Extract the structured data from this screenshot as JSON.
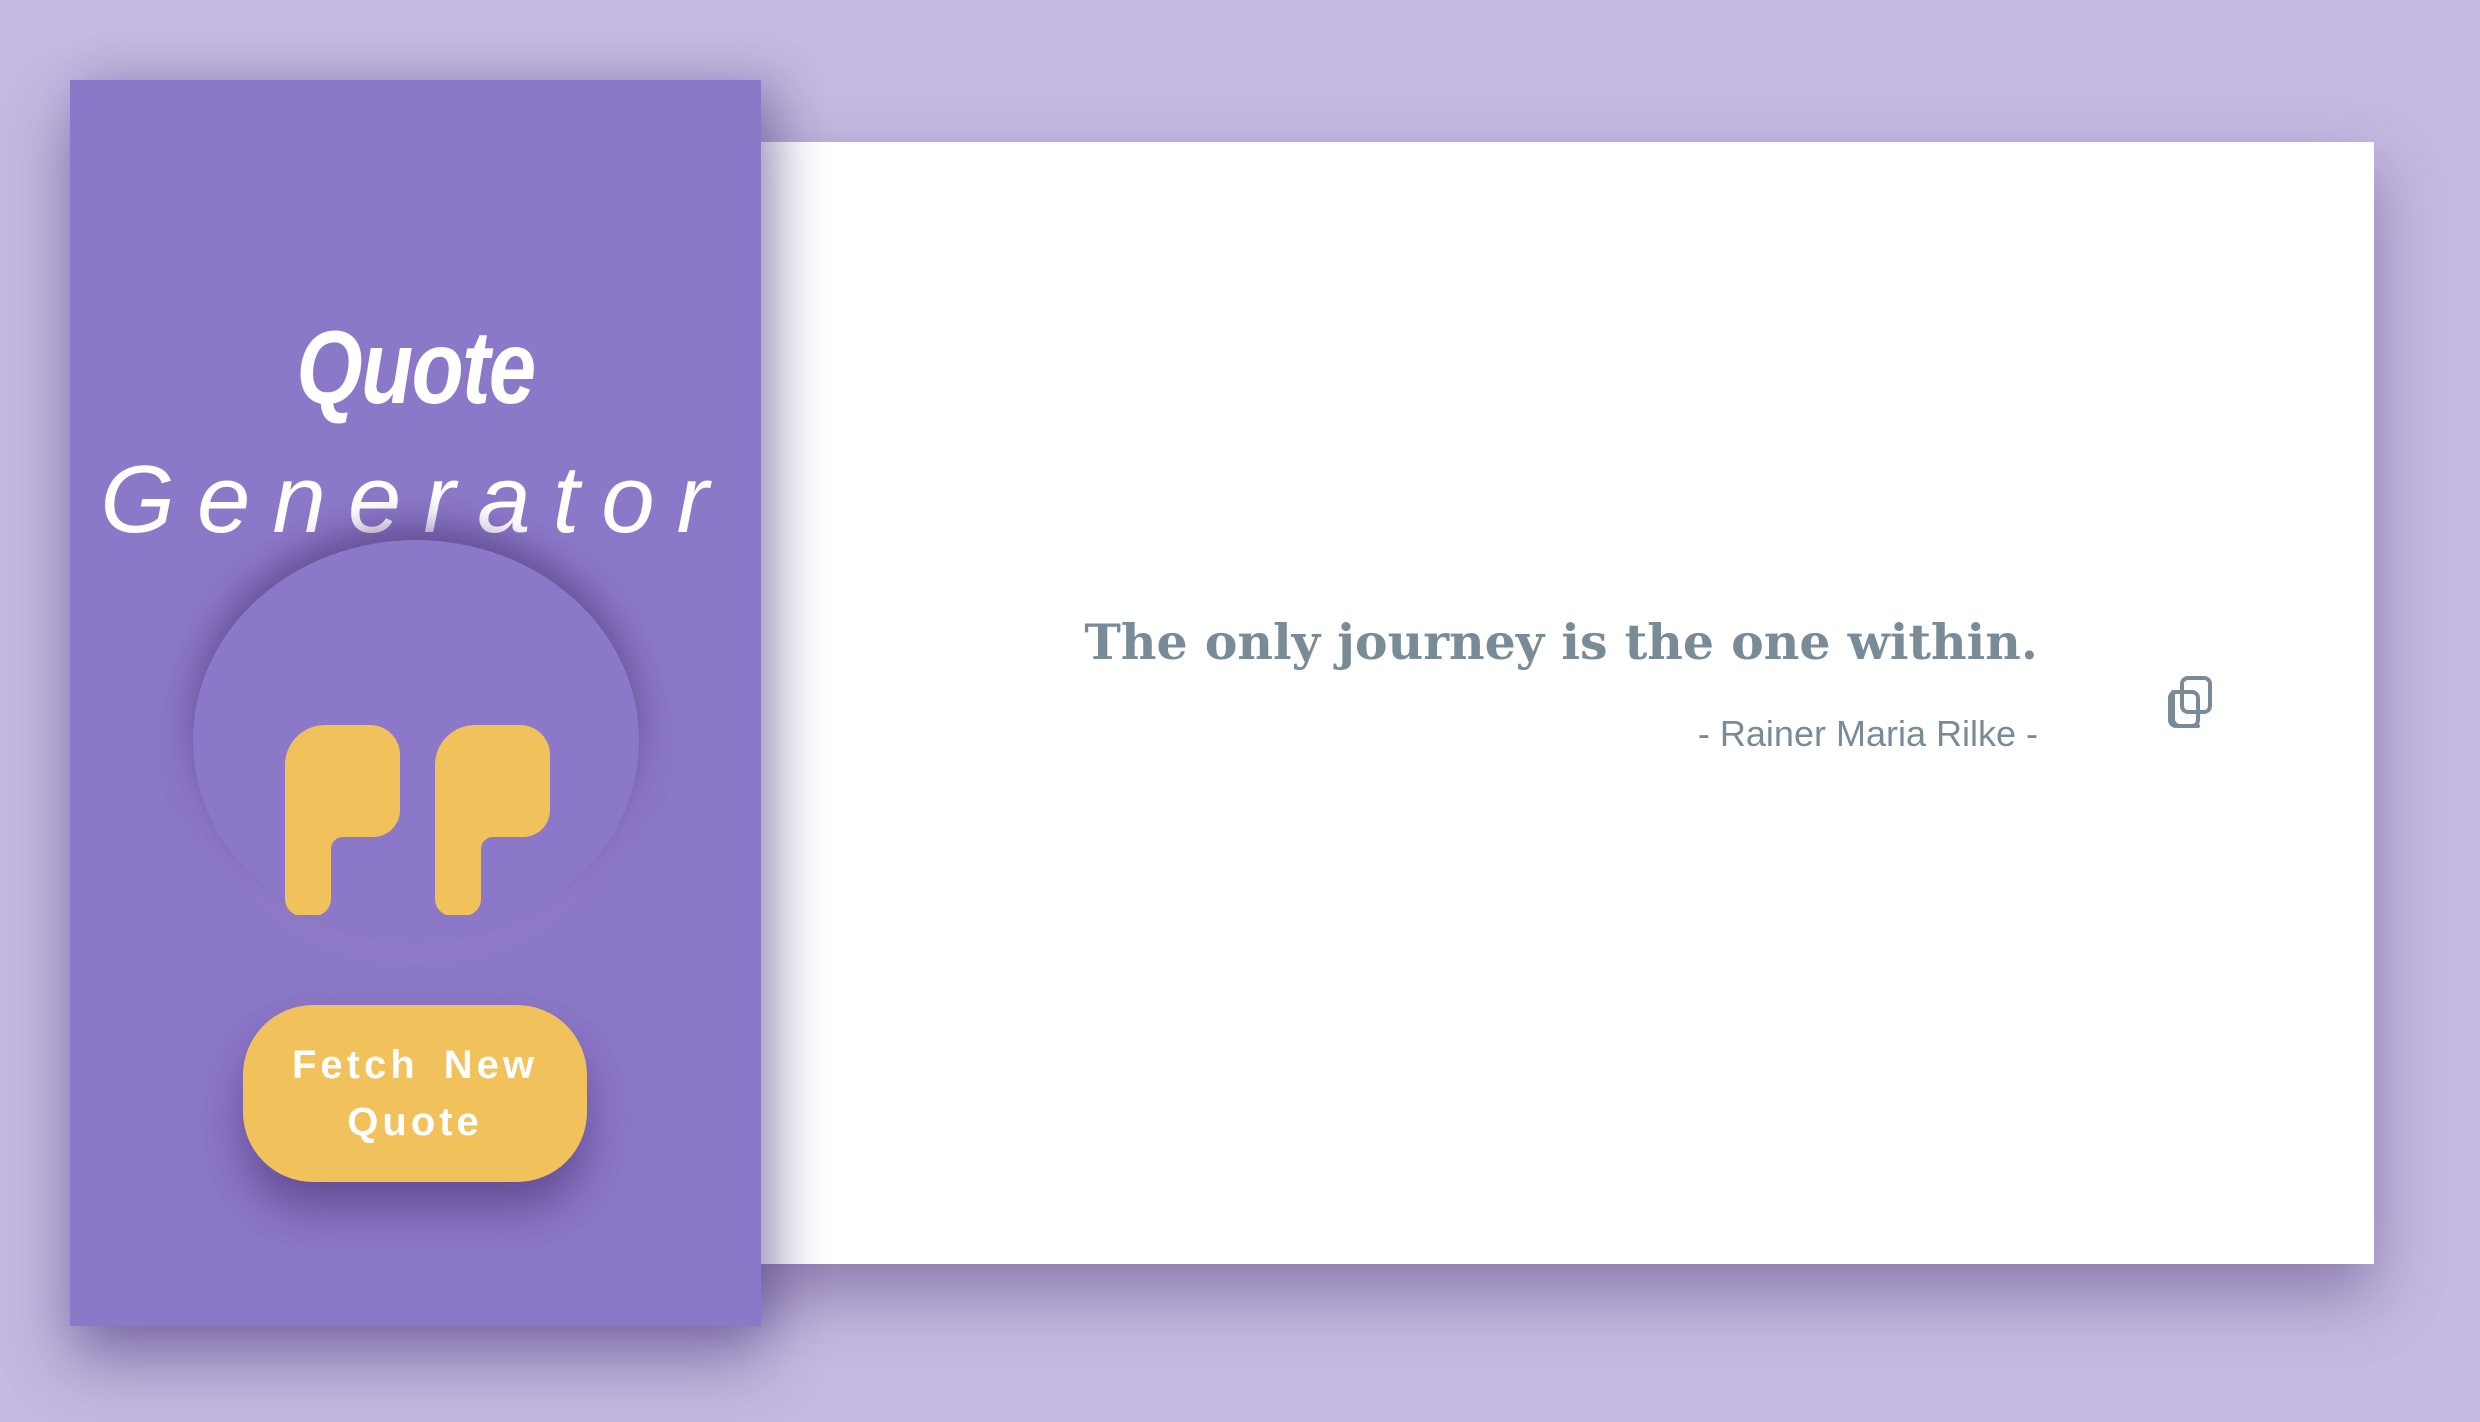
{
  "app": {
    "title_line1": "Quote",
    "title_line2": "Generator"
  },
  "hero_icon": "quote-marks-icon",
  "button": {
    "label": "Fetch New Quote"
  },
  "quote": {
    "text": "The only journey is the one within.",
    "author": "- Rainer Maria Rilke -"
  },
  "copy_icon": "copy-icon",
  "colors": {
    "background": "#c5b9e1",
    "panel": "#8c78c8",
    "accent": "#f1c15c",
    "quote_text": "#798b97",
    "card": "#ffffff"
  }
}
